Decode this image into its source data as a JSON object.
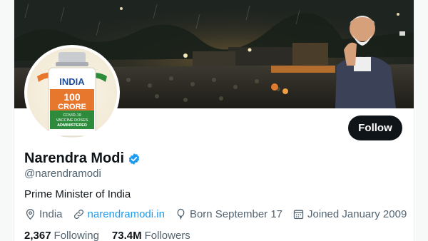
{
  "profile": {
    "avatar": {
      "top_text": "INDIA",
      "count": "100",
      "unit": "CRORE",
      "subtitle_line1": "COVID-19",
      "subtitle_line2": "VACCINE DOSES",
      "subtitle_line3": "ADMINISTERED"
    },
    "display_name": "Narendra Modi",
    "handle": "@narendramodi",
    "bio": "Prime Minister of India",
    "location": "India",
    "website": "narendramodi.in",
    "birthday": "Born September 17",
    "joined": "Joined January 2009",
    "following_count": "2,367",
    "following_label": "Following",
    "followers_count": "73.4M",
    "followers_label": "Followers"
  },
  "actions": {
    "follow_label": "Follow"
  },
  "icons": {
    "verified": "verified-badge-icon",
    "location": "location-pin-icon",
    "website": "link-icon",
    "birthday": "balloon-icon",
    "joined": "calendar-icon"
  },
  "colors": {
    "accent": "#1d9bf0",
    "text_primary": "#0f1419",
    "text_secondary": "#536471",
    "button_bg": "#0f1419",
    "avatar_orange": "#e8772e",
    "avatar_green": "#2e8b3c",
    "avatar_blue": "#1f4f9c"
  }
}
